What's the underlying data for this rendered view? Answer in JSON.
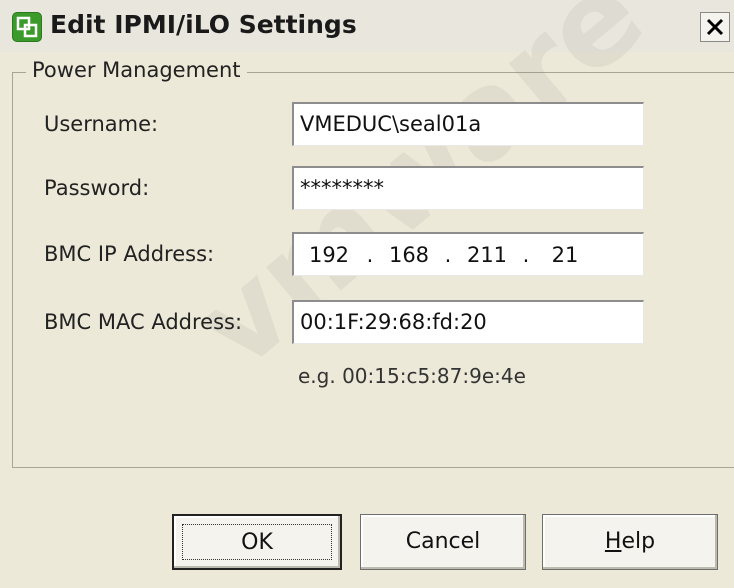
{
  "window": {
    "title": "Edit IPMI/iLO Settings",
    "close_glyph": "X"
  },
  "group": {
    "legend": "Power Management"
  },
  "fields": {
    "username_label": "Username:",
    "username_value": "VMEDUC\\seal01a",
    "password_label": "Password:",
    "password_value": "********",
    "bmc_ip_label": "BMC IP Address:",
    "bmc_ip_octets": [
      "192",
      "168",
      "211",
      "21"
    ],
    "bmc_ip_dot": ".",
    "bmc_mac_label": "BMC MAC Address:",
    "bmc_mac_value": "00:1F:29:68:fd:20",
    "mac_hint": "e.g. 00:15:c5:87:9e:4e"
  },
  "buttons": {
    "ok": "OK",
    "cancel": "Cancel",
    "help_first": "H",
    "help_rest": "elp"
  },
  "watermark": "vmware",
  "colors": {
    "dialog_bg": "#ece9d8",
    "icon_green": "#3a9a2a"
  },
  "icons": {
    "title_icon": "vsphere-logo-icon",
    "close_icon": "close-icon"
  }
}
